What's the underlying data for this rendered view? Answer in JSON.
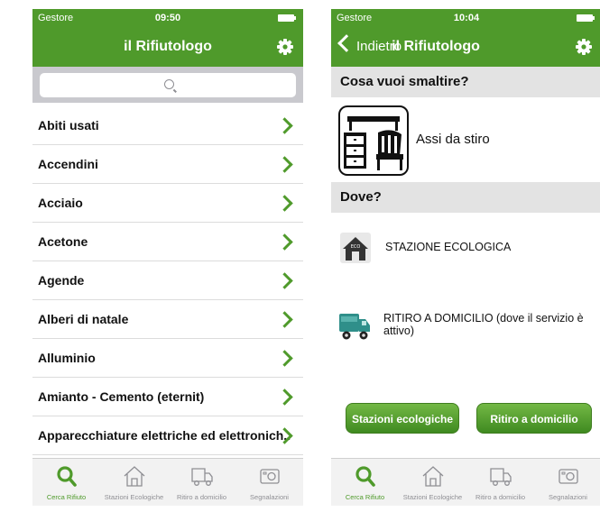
{
  "left": {
    "statusbar": {
      "carrier": "Gestore",
      "time": "09:50"
    },
    "title": "il Rifiutologo",
    "items": [
      "Abiti usati",
      "Accendini",
      "Acciaio",
      "Acetone",
      "Agende",
      "Alberi di natale",
      "Alluminio",
      "Amianto - Cemento (eternit)",
      "Apparecchiature elettriche ed elettronich..."
    ]
  },
  "right": {
    "statusbar": {
      "carrier": "Gestore",
      "time": "10:04"
    },
    "back": "Indietro",
    "title": "il Rifiutologo",
    "what_header": "Cosa vuoi smaltire?",
    "item_name": "Assi da stiro",
    "where_header": "Dove?",
    "station": "STAZIONE ECOLOGICA",
    "pickup": "RITIRO A DOMICILIO (dove il servizio è attivo)",
    "btn_stations": "Stazioni ecologiche",
    "btn_pickup": "Ritiro a domicilio"
  },
  "tabs": [
    {
      "label": "Cerca Rifiuto",
      "icon": "search-icon"
    },
    {
      "label": "Stazioni Ecologiche",
      "icon": "home-icon"
    },
    {
      "label": "Ritiro a domicilio",
      "icon": "truck-icon"
    },
    {
      "label": "Segnalazioni",
      "icon": "camera-icon"
    }
  ],
  "colors": {
    "brand": "#4f9a2b",
    "section_bg": "#e3e3e3",
    "tab_inactive": "#8e8e93"
  }
}
